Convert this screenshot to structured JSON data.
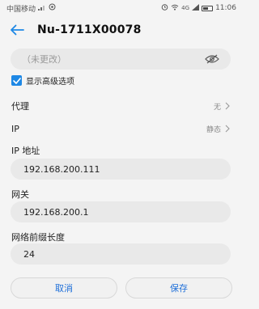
{
  "status_bar": {
    "carrier": "中国移动",
    "signal_text": "4G",
    "time": "11:06"
  },
  "app_bar": {
    "title": "Nu-1711X00078"
  },
  "password": {
    "placeholder": "（未更改）"
  },
  "advanced": {
    "label": "显示高级选项",
    "checked": true
  },
  "proxy": {
    "label": "代理",
    "value": "无"
  },
  "ip_setting": {
    "label": "IP",
    "value": "静态"
  },
  "ip_address": {
    "label": "IP 地址",
    "value": "192.168.200.111"
  },
  "gateway": {
    "label": "网关",
    "value": "192.168.200.1"
  },
  "prefix_length": {
    "label": "网络前缀长度",
    "value": "24"
  },
  "buttons": {
    "cancel": "取消",
    "save": "保存"
  },
  "colors": {
    "accent": "#1e88e5",
    "field_bg": "#e9e9e9",
    "page_bg": "#f4f4f4"
  }
}
